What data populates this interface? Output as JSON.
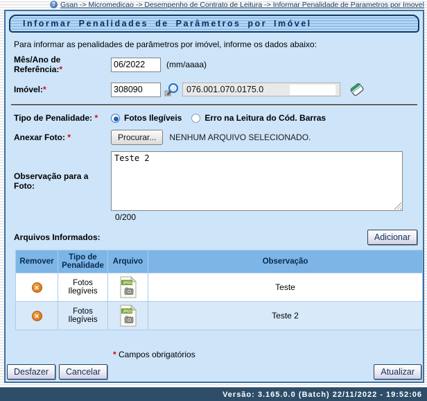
{
  "breadcrumb": {
    "help_icon": "?",
    "path": "Gsan -> Micromedicao -> Desempenho de Contrato de Leitura -> Informar Penalidade de Parametros por Imovel"
  },
  "header": {
    "title": "Informar Penalidades de Parâmetros por Imóvel"
  },
  "intro": "Para informar as penalidades de parâmetros por imóvel, informe os dados abaixo:",
  "required_mark": "*",
  "form": {
    "mes_ano": {
      "label": "Mês/Ano de\nReferência:",
      "value": "06/2022",
      "format_hint": "(mm/aaaa)"
    },
    "imovel": {
      "label": "Imóvel:",
      "value": "308090",
      "inscricao": "076.001.070.0175.0"
    },
    "tipo_penalidade": {
      "label": "Tipo de Penalidade:",
      "options": [
        {
          "label": "Fotos Ilegíveis",
          "selected": true
        },
        {
          "label": "Erro na Leitura do Cód. Barras",
          "selected": false
        }
      ]
    },
    "anexar_foto": {
      "label": "Anexar Foto:",
      "browse_button": "Procurar...",
      "status": "NENHUM ARQUIVO SELECIONADO."
    },
    "observacao": {
      "label": "Observação para a\nFoto:",
      "value": "Teste 2",
      "counter": "0/200"
    }
  },
  "arquivos": {
    "section_label": "Arquivos Informados:",
    "add_button": "Adicionar",
    "table": {
      "headers": [
        "Remover",
        "Tipo de Penalidade",
        "Arquivo",
        "Observação"
      ],
      "rows": [
        {
          "tipo": "Fotos Ilegíveis",
          "arquivo": "jpeg-file-icon",
          "observacao": "Teste"
        },
        {
          "tipo": "Fotos Ilegíveis",
          "arquivo": "jpeg-file-icon",
          "observacao": "Teste 2"
        }
      ]
    }
  },
  "notes": {
    "required_legend": " Campos obrigatórios"
  },
  "buttons": {
    "desfazer": "Desfazer",
    "cancelar": "Cancelar",
    "atualizar": "Atualizar"
  },
  "statusbar": {
    "version": "Versão: 3.165.0.0 (Batch) 22/11/2022 - 19:52:06"
  },
  "icons": {
    "remove_glyph": "✕",
    "jpeg_label": "JPEG"
  },
  "colors": {
    "panel_bg": "#cde4f9",
    "panel_border": "#3d6f9e",
    "title_border": "#0e3a63",
    "table_header_bg": "#7db5e7",
    "row_alt_bg": "#d8e9fa",
    "footer_bg": "#2e4d68",
    "required": "#dd0000",
    "remove_icon": "#d2690d"
  }
}
